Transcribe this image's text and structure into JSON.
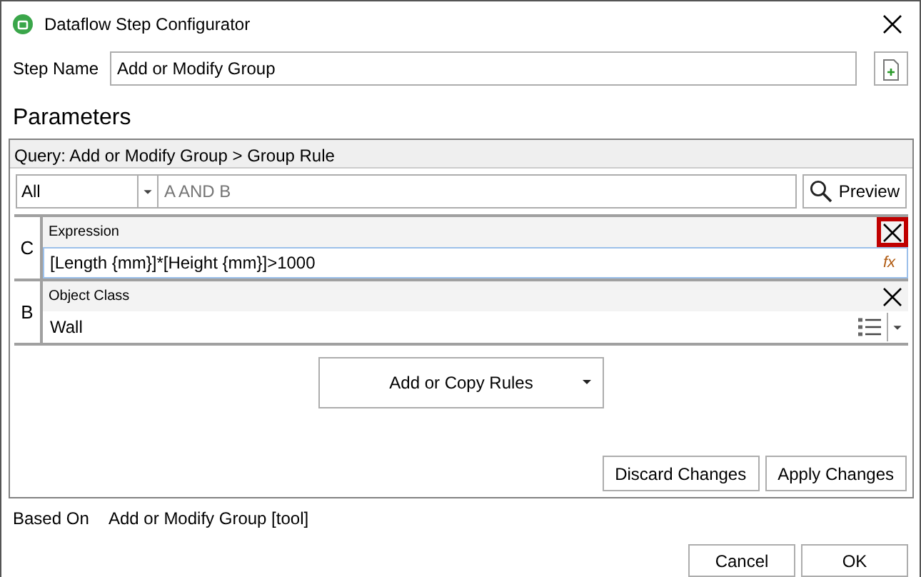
{
  "window": {
    "title": "Dataflow Step Configurator"
  },
  "step_name": {
    "label": "Step Name",
    "value": "Add or Modify Group"
  },
  "parameters": {
    "heading": "Parameters",
    "query_path": "Query: Add or Modify Group > Group Rule",
    "filter": {
      "mode": "All",
      "placeholder": "A AND B",
      "preview": "Preview"
    },
    "rules": [
      {
        "letter": "C",
        "label": "Expression",
        "value": "[Length {mm}]*[Height {mm}]>1000",
        "kind": "expression",
        "focused": true,
        "close_highlighted": true,
        "fx": "fx"
      },
      {
        "letter": "B",
        "label": "Object Class",
        "value": "Wall",
        "kind": "list",
        "focused": false,
        "close_highlighted": false
      }
    ],
    "add_rules": "Add or Copy Rules",
    "discard": "Discard Changes",
    "apply": "Apply Changes"
  },
  "based_on": {
    "label": "Based On",
    "value": "Add or Modify Group [tool]"
  },
  "buttons": [
    "Cancel",
    "OK"
  ]
}
